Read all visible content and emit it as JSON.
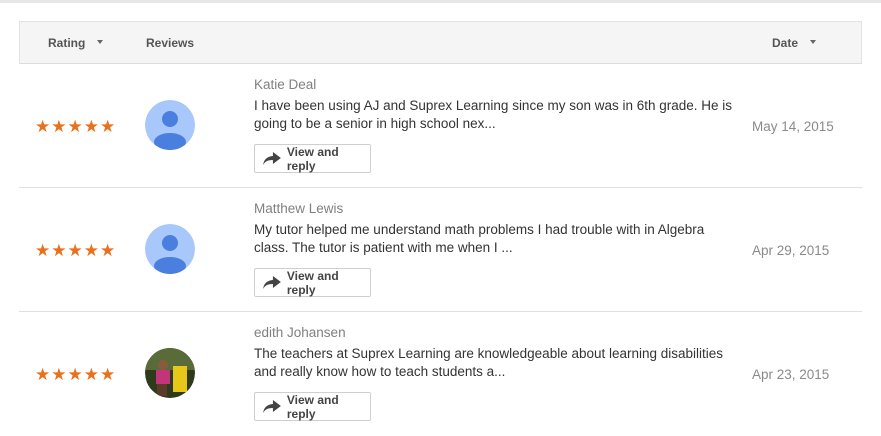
{
  "header": {
    "rating_label": "Rating",
    "reviews_label": "Reviews",
    "date_label": "Date"
  },
  "reviews": [
    {
      "stars": "★★★★★",
      "rating": 5,
      "name": "Katie Deal",
      "text": "I have been using AJ and Suprex Learning since my son was in 6th grade. He is going to be a senior in high school nex...",
      "action_label": "View and reply",
      "date": "May 14, 2015",
      "avatar": "default-avatar-icon"
    },
    {
      "stars": "★★★★★",
      "rating": 5,
      "name": "Matthew Lewis",
      "text": "My tutor helped me understand math problems I had trouble with in Algebra class. The tutor is patient with me when I ...",
      "action_label": "View and reply",
      "date": "Apr 29, 2015",
      "avatar": "default-avatar-icon"
    },
    {
      "stars": "★★★★★",
      "rating": 5,
      "name": "edith Johansen",
      "text": "The teachers at Suprex Learning are knowledgeable about learning disabilities and really know how to teach students a...",
      "action_label": "View and reply",
      "date": "Apr 23, 2015",
      "avatar": "photo-avatar"
    }
  ],
  "colors": {
    "star": "#e8711d",
    "avatar_bg": "#a8c7fa",
    "avatar_fg": "#4a7fe0"
  }
}
